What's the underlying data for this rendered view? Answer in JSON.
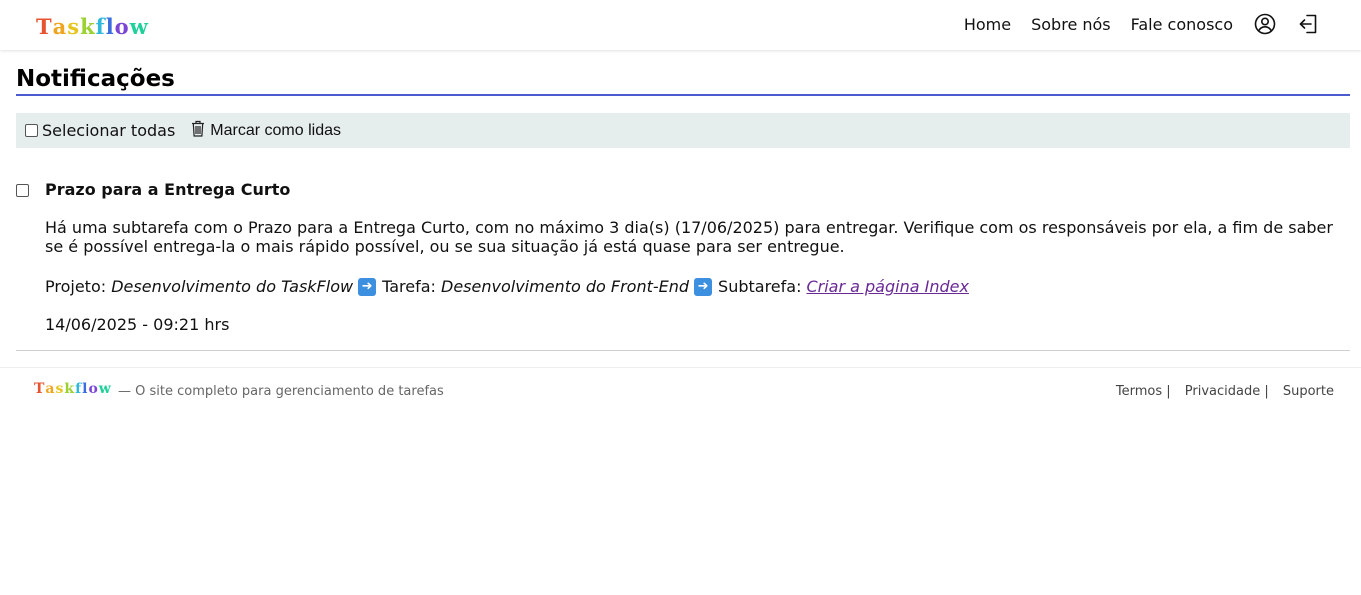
{
  "header": {
    "logo_letters": [
      {
        "ch": "T",
        "color": "#e8532f"
      },
      {
        "ch": "a",
        "color": "#f0a51e"
      },
      {
        "ch": "s",
        "color": "#e6c51f"
      },
      {
        "ch": "k",
        "color": "#9bd232"
      },
      {
        "ch": "f",
        "color": "#2fb8d9"
      },
      {
        "ch": "l",
        "color": "#3a6de0"
      },
      {
        "ch": "o",
        "color": "#7b45d6"
      },
      {
        "ch": "w",
        "color": "#1fd09a"
      }
    ],
    "nav": {
      "home": "Home",
      "about": "Sobre nós",
      "contact": "Fale conosco"
    },
    "icons": {
      "profile": "user-circle-icon",
      "logout": "logout-icon"
    }
  },
  "page": {
    "title": "Notificações",
    "accent": "#4a5bd0"
  },
  "toolbar": {
    "select_all_label": "Selecionar todas",
    "mark_read_label": "Marcar como lidas",
    "mark_icon": "trash-icon",
    "background": "#e6eded"
  },
  "notification": {
    "title": "Prazo para a Entrega Curto",
    "body": "Há uma subtarefa com o Prazo para a Entrega Curto, com no máximo 3 dia(s) (17/06/2025) para entregar. Verifique com os responsáveis por ela, a fim de saber se é possível entrega-la o mais rápido possível, ou se sua situação já está quase para ser entregue.",
    "project_label": "Projeto:",
    "project_name": "Desenvolvimento do TaskFlow",
    "task_label": "Tarefa:",
    "task_name": "Desenvolvimento do Front-End",
    "subtask_label": "Subtarefa:",
    "subtask_link": "Criar a página Index",
    "arrow_icon": "arrow-right-icon",
    "datetime": "14/06/2025 - 09:21 hrs"
  },
  "footer": {
    "tagline": "— O site completo para gerenciamento de tarefas",
    "links": {
      "terms": "Termos |",
      "privacy": "Privacidade |",
      "support": "Suporte"
    }
  }
}
